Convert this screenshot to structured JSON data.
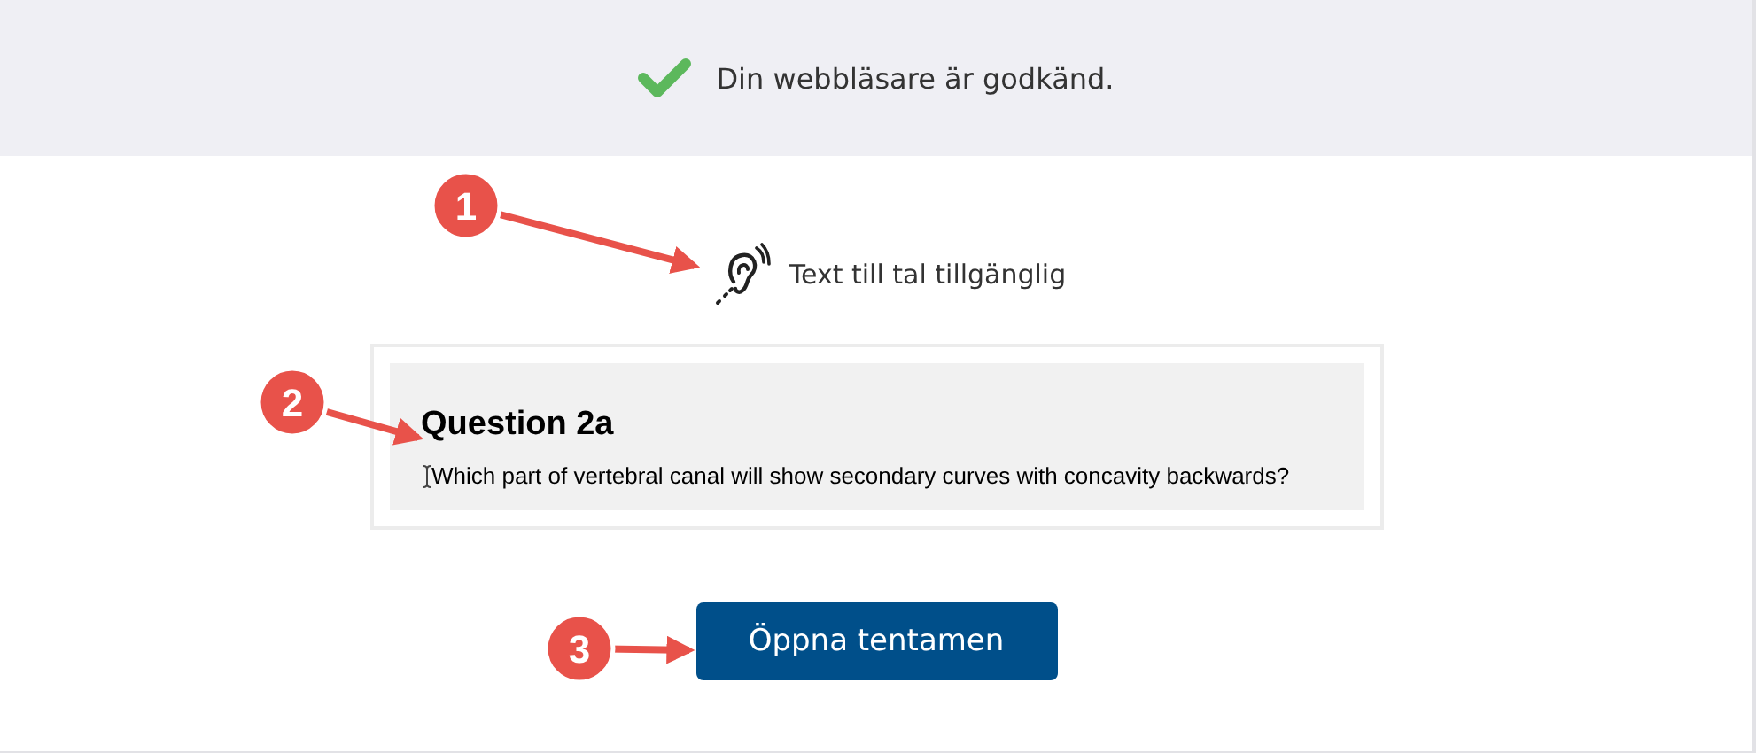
{
  "banner": {
    "message": "Din webbläsare är godkänd."
  },
  "text_to_speech": {
    "label": "Text till tal tillgänglig"
  },
  "preview": {
    "title": "Question 2a",
    "question": "Which part of vertebral canal will show secondary curves with concavity backwards?"
  },
  "button": {
    "label": "Öppna tentamen"
  },
  "callouts": [
    {
      "number": "1"
    },
    {
      "number": "2"
    },
    {
      "number": "3"
    }
  ]
}
